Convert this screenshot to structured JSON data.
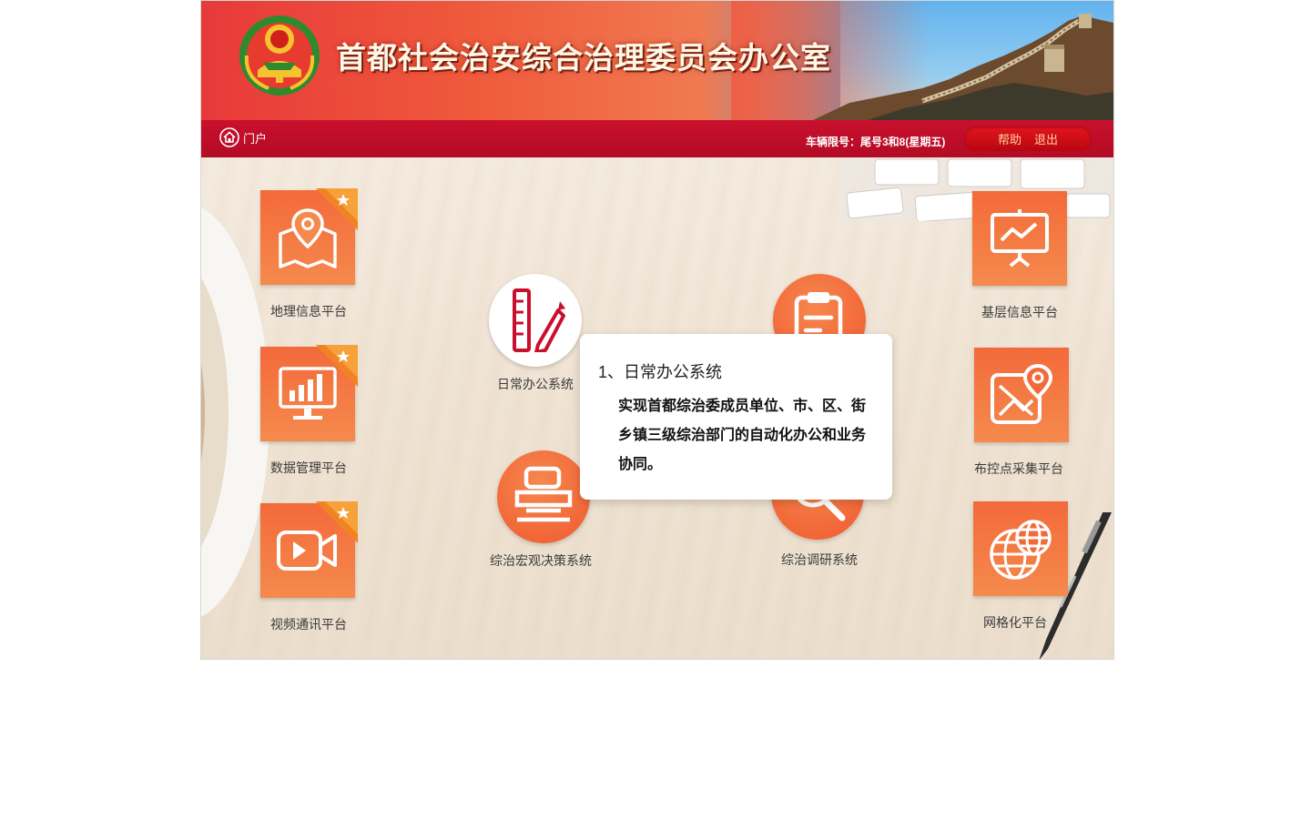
{
  "header": {
    "site_title": "首都社会治安综合治理委员会办公室"
  },
  "navbar": {
    "home_label": "门户",
    "traffic_restriction": "车辆限号：尾号3和8(星期五)",
    "help_label": "帮助",
    "logout_label": "退出"
  },
  "left_platforms": [
    {
      "label": "地理信息平台",
      "icon": "map-pin-icon",
      "starred": true
    },
    {
      "label": "数据管理平台",
      "icon": "bar-chart-monitor-icon",
      "starred": true
    },
    {
      "label": "视频通讯平台",
      "icon": "video-camera-icon",
      "starred": true
    }
  ],
  "center_systems": [
    {
      "label": "日常办公系统",
      "icon": "ruler-pencil-icon"
    },
    {
      "label": "",
      "icon": "clipboard-check-icon"
    },
    {
      "label": "综治宏观决策系统",
      "icon": "telescope-icon"
    },
    {
      "label": "综治调研系统",
      "icon": "magnifier-icon"
    }
  ],
  "right_platforms": [
    {
      "label": "基层信息平台",
      "icon": "presentation-board-icon"
    },
    {
      "label": "布控点采集平台",
      "icon": "map-location-icon"
    },
    {
      "label": "网格化平台",
      "icon": "globe-icon"
    }
  ],
  "popup": {
    "title": "1、日常办公系统",
    "body": "实现首都综治委成员单位、市、区、街乡镇三级综治部门的自动化办公和业务协同。"
  },
  "colors": {
    "banner_red": "#e8393a",
    "navbar_red": "#c9102d",
    "tile_orange": "#f36a3a",
    "action_text": "#ffd39b"
  }
}
